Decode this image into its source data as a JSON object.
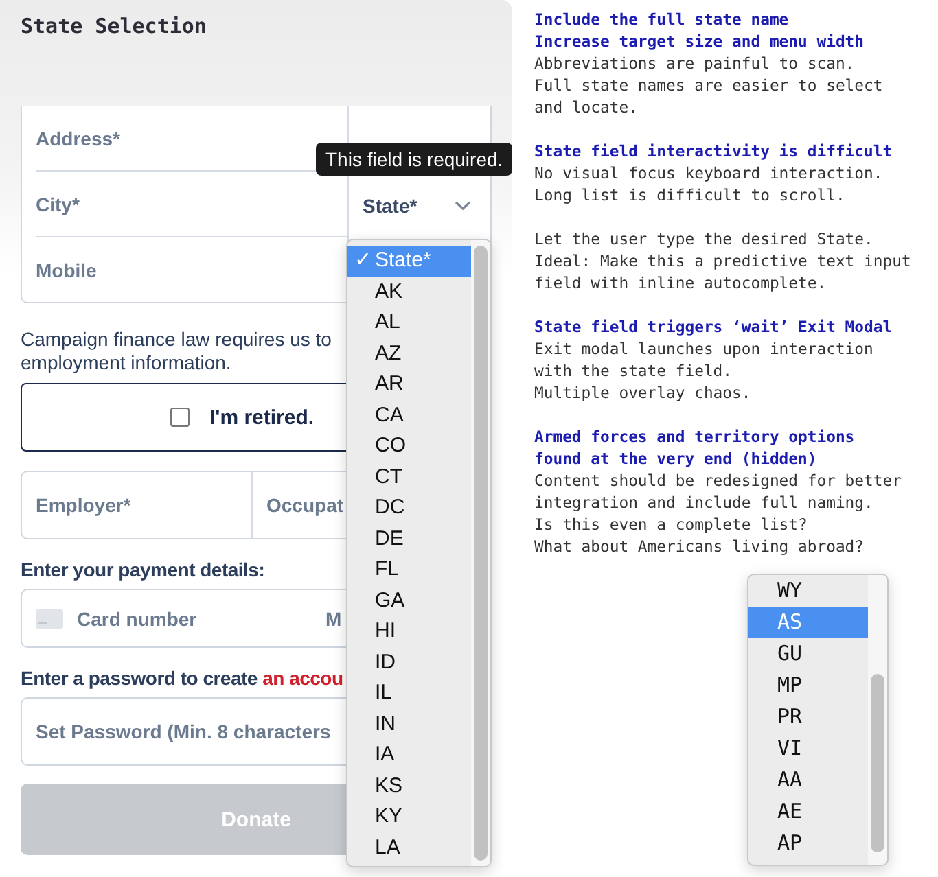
{
  "title": "State Selection",
  "form": {
    "address_rows": [
      {
        "placeholder": "Address*"
      },
      {
        "placeholder": "City*"
      },
      {
        "placeholder": "Mobile"
      }
    ],
    "state_select": {
      "label": "State*"
    },
    "tooltip": "This field is required.",
    "employment_notice": [
      "Campaign finance law requires us to",
      "employment information."
    ],
    "retired": {
      "label": "I'm retired.",
      "checked": false
    },
    "employment_fields": [
      {
        "placeholder": "Employer*"
      },
      {
        "placeholder": "Occupat"
      }
    ],
    "payment_label": "Enter your payment details:",
    "card_fields": [
      {
        "placeholder": "Card number"
      },
      {
        "placeholder": "M"
      }
    ],
    "password_label": {
      "text": "Enter a password to create",
      "link": "an accou"
    },
    "password_field": {
      "placeholder": "Set Password (Min. 8 characters"
    },
    "donate_button": {
      "label": "Donate",
      "disabled": true
    }
  },
  "state_menu": {
    "check_mark": "✓",
    "options": [
      {
        "label": "State*",
        "selected": true
      },
      {
        "label": "AK",
        "selected": false
      },
      {
        "label": "AL",
        "selected": false
      },
      {
        "label": "AZ",
        "selected": false
      },
      {
        "label": "AR",
        "selected": false
      },
      {
        "label": "CA",
        "selected": false
      },
      {
        "label": "CO",
        "selected": false
      },
      {
        "label": "CT",
        "selected": false
      },
      {
        "label": "DC",
        "selected": false
      },
      {
        "label": "DE",
        "selected": false
      },
      {
        "label": "FL",
        "selected": false
      },
      {
        "label": "GA",
        "selected": false
      },
      {
        "label": "HI",
        "selected": false
      },
      {
        "label": "ID",
        "selected": false
      },
      {
        "label": "IL",
        "selected": false
      },
      {
        "label": "IN",
        "selected": false
      },
      {
        "label": "IA",
        "selected": false
      },
      {
        "label": "KS",
        "selected": false
      },
      {
        "label": "KY",
        "selected": false
      },
      {
        "label": "LA",
        "selected": false
      }
    ]
  },
  "notes": [
    {
      "heading": [
        "Include the full state name",
        "Increase target size and menu width"
      ],
      "paragraphs": [
        [
          "Abbreviations are painful to scan.",
          "Full state names are easier to select",
          "and locate."
        ]
      ]
    },
    {
      "heading": [
        "State field interactivity is difficult"
      ],
      "paragraphs": [
        [
          "No visual focus keyboard interaction.",
          "Long list is difficult to scroll."
        ],
        [
          "Let the user type the desired State.",
          "Ideal: Make this a predictive text input",
          "field with inline autocomplete."
        ]
      ]
    },
    {
      "heading": [
        "State field triggers ‘wait’ Exit Modal"
      ],
      "paragraphs": [
        [
          "Exit modal launches upon interaction",
          "with the state field.",
          "Multiple overlay chaos."
        ]
      ]
    },
    {
      "heading": [
        "Armed forces and territory options",
        "found at the very end (hidden)"
      ],
      "paragraphs": [
        [
          "Content should be redesigned for better",
          "integration and include full naming.",
          "Is this even a complete list?",
          "What about Americans living abroad?"
        ]
      ]
    }
  ],
  "state_menu_end": {
    "options": [
      {
        "label": "WY",
        "selected": false
      },
      {
        "label": "AS",
        "selected": true
      },
      {
        "label": "GU",
        "selected": false
      },
      {
        "label": "MP",
        "selected": false
      },
      {
        "label": "PR",
        "selected": false
      },
      {
        "label": "VI",
        "selected": false
      },
      {
        "label": "AA",
        "selected": false
      },
      {
        "label": "AE",
        "selected": false
      },
      {
        "label": "AP",
        "selected": false
      }
    ]
  }
}
